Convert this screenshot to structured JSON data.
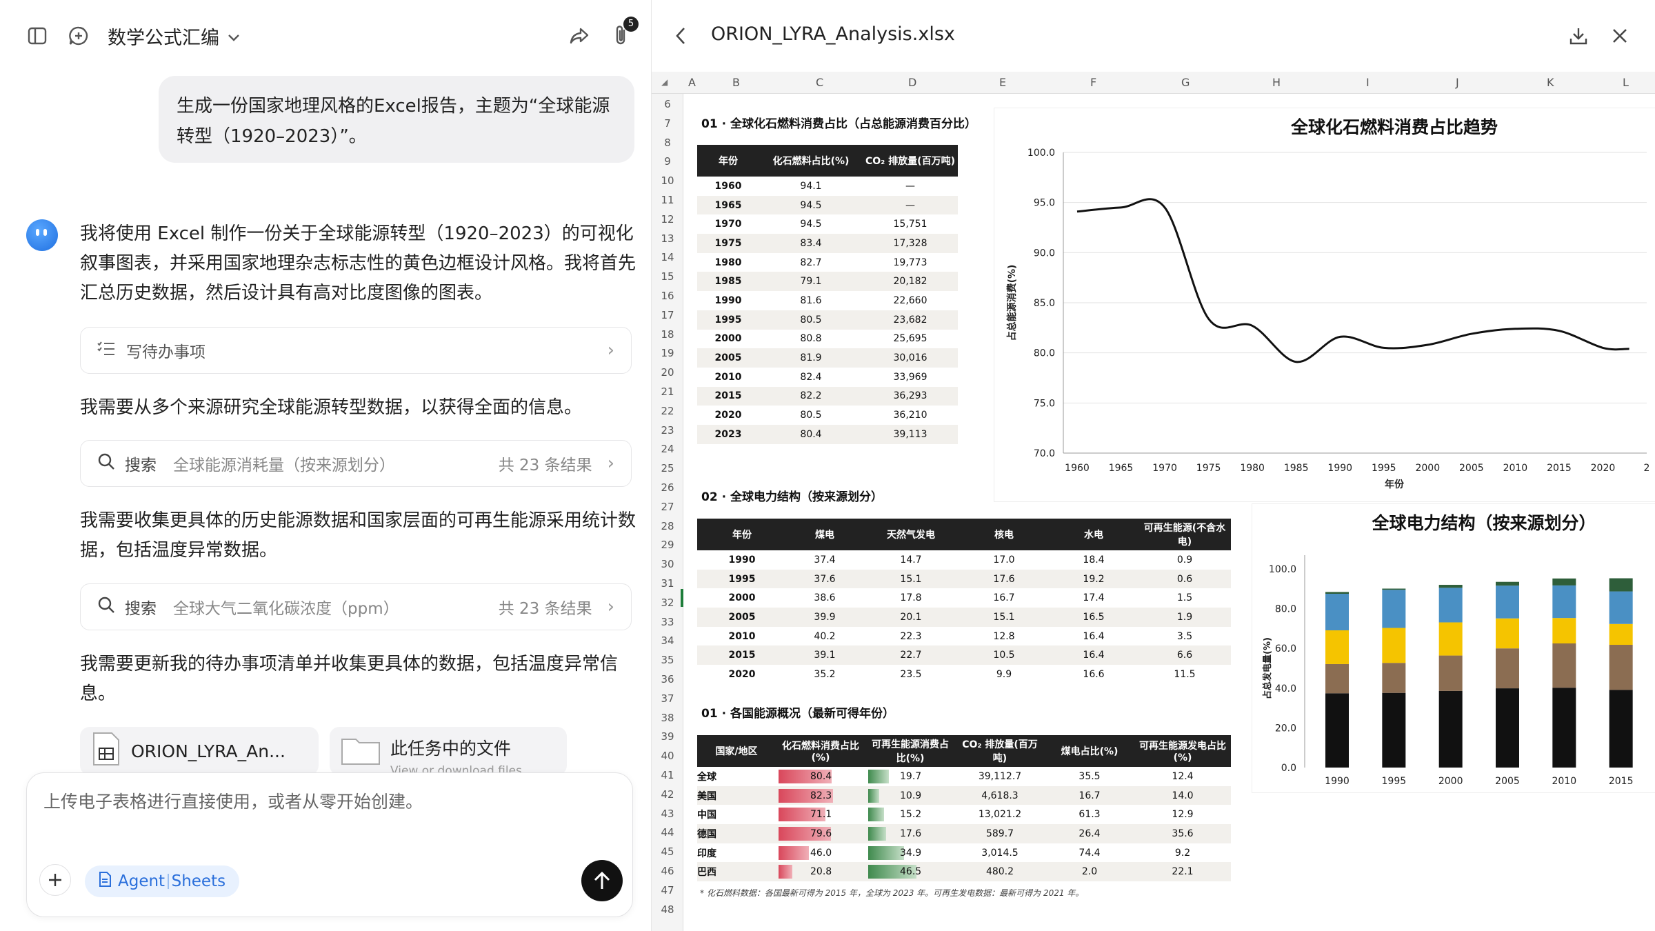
{
  "left": {
    "chat_title": "数学公式汇编",
    "attach_badge": "5",
    "user_message": "生成一份国家地理风格的Excel报告，主题为“全球能源转型（1920–2023）”。",
    "ai_intro": "我将使用 Excel 制作一份关于全球能源转型（1920–2023）的可视化叙事图表，并采用国家地理杂志标志性的黄色边框设计风格。我将首先汇总历史数据，然后设计具有高对比度图像的图表。",
    "todo_label": "写待办事项",
    "para2": "我需要从多个来源研究全球能源转型数据，以获得全面的信息。",
    "search1": {
      "label": "搜索",
      "query": "全球能源消耗量（按来源划分）",
      "count": "共 23 条结果"
    },
    "para3": "我需要收集更具体的历史能源数据和国家层面的可再生能源采用统计数据，包括温度异常数据。",
    "search2": {
      "label": "搜索",
      "query": "全球大气二氧化碳浓度（ppm）",
      "count": "共 23 条结果"
    },
    "para4": "我需要更新我的待办事项清单并收集更具体的数据，包括温度异常信息。",
    "file1": "ORION_LYRA_An...",
    "file2": "此任务中的文件",
    "file2_sub": "View or download files",
    "input_placeholder": "上传电子表格进行直接使用，或者从零开始创建。",
    "agent_label": "Agent",
    "sheets_label": "Sheets"
  },
  "right": {
    "file_title": "ORION_LYRA_Analysis.xlsx",
    "col_headers": [
      "A",
      "B",
      "C",
      "D",
      "E",
      "F",
      "G",
      "H",
      "I",
      "J",
      "K",
      "L"
    ],
    "row_numbers": [
      "6",
      "7",
      "8",
      "9",
      "10",
      "11",
      "12",
      "13",
      "14",
      "15",
      "16",
      "17",
      "18",
      "19",
      "20",
      "21",
      "22",
      "23",
      "24",
      "25",
      "26",
      "27",
      "28",
      "29",
      "30",
      "31",
      "32",
      "33",
      "34",
      "35",
      "36",
      "37",
      "38",
      "39",
      "40",
      "41",
      "42",
      "43",
      "44",
      "45",
      "46",
      "47",
      "48"
    ],
    "sec1": {
      "title": "01 · 全球化石燃料消费占比（占总能源消费百分比）",
      "headers": [
        "年份",
        "化石燃料占比(%)",
        "CO₂ 排放量(百万吨)"
      ],
      "rows": [
        [
          "1960",
          "94.1",
          "—"
        ],
        [
          "1965",
          "94.5",
          "—"
        ],
        [
          "1970",
          "94.5",
          "15,751"
        ],
        [
          "1975",
          "83.4",
          "17,328"
        ],
        [
          "1980",
          "82.7",
          "19,773"
        ],
        [
          "1985",
          "79.1",
          "20,182"
        ],
        [
          "1990",
          "81.6",
          "22,660"
        ],
        [
          "1995",
          "80.5",
          "23,682"
        ],
        [
          "2000",
          "80.8",
          "25,695"
        ],
        [
          "2005",
          "81.9",
          "30,016"
        ],
        [
          "2010",
          "82.4",
          "33,969"
        ],
        [
          "2015",
          "82.2",
          "36,293"
        ],
        [
          "2020",
          "80.5",
          "36,210"
        ],
        [
          "2023",
          "80.4",
          "39,113"
        ]
      ]
    },
    "sec2": {
      "title": "02 · 全球电力结构（按来源划分）",
      "headers": [
        "年份",
        "煤电",
        "天然气发电",
        "核电",
        "水电",
        "可再生能源(不含水电)"
      ],
      "rows": [
        [
          "1990",
          "37.4",
          "14.7",
          "17.0",
          "18.4",
          "0.9"
        ],
        [
          "1995",
          "37.6",
          "15.1",
          "17.6",
          "19.2",
          "0.6"
        ],
        [
          "2000",
          "38.6",
          "17.8",
          "16.7",
          "17.4",
          "1.5"
        ],
        [
          "2005",
          "39.9",
          "20.1",
          "15.1",
          "16.5",
          "1.9"
        ],
        [
          "2010",
          "40.2",
          "22.3",
          "12.8",
          "16.4",
          "3.5"
        ],
        [
          "2015",
          "39.1",
          "22.7",
          "10.5",
          "16.4",
          "6.6"
        ],
        [
          "2020",
          "35.2",
          "23.5",
          "9.9",
          "16.6",
          "11.5"
        ]
      ]
    },
    "sec3": {
      "title": "01 · 各国能源概况（最新可得年份）",
      "headers": [
        "国家/地区",
        "化石燃料消费占比(%)",
        "可再生能源消费占比(%)",
        "CO₂ 排放量(百万吨)",
        "煤电占比(%)",
        "可再生能源发电占比(%)"
      ],
      "rows": [
        [
          "全球",
          "80.4",
          "19.7",
          "39,112.7",
          "35.5",
          "12.4"
        ],
        [
          "美国",
          "82.3",
          "10.9",
          "4,618.3",
          "16.7",
          "14.0"
        ],
        [
          "中国",
          "71.1",
          "15.2",
          "13,021.2",
          "61.3",
          "12.9"
        ],
        [
          "德国",
          "79.6",
          "17.6",
          "589.7",
          "26.4",
          "35.6"
        ],
        [
          "印度",
          "46.0",
          "34.9",
          "3,014.5",
          "74.4",
          "9.2"
        ],
        [
          "巴西",
          "20.8",
          "46.5",
          "480.2",
          "2.0",
          "22.1"
        ]
      ],
      "fossil_bar_values": [
        80.4,
        82.3,
        71.1,
        79.6,
        46.0,
        20.8
      ],
      "renew_bar_values": [
        19.7,
        10.9,
        15.2,
        17.6,
        34.9,
        46.5
      ]
    },
    "footnote": "* 化石燃料数据：各国最新可得为 2015 年，全球为 2023 年。可再生发电数据：最新可得为 2021 年。"
  },
  "chart_data": [
    {
      "type": "line",
      "title": "全球化石燃料消费占比趋势",
      "xlabel": "年份",
      "ylabel": "占总能源消费(%)",
      "ylim": [
        70,
        100
      ],
      "yticks": [
        "100.0",
        "95.0",
        "90.0",
        "85.0",
        "80.0",
        "75.0",
        "70.0"
      ],
      "xticks": [
        "1960",
        "1965",
        "1970",
        "1975",
        "1980",
        "1985",
        "1990",
        "1995",
        "2000",
        "2005",
        "2010",
        "2015",
        "2020",
        "2"
      ],
      "x": [
        1960,
        1965,
        1970,
        1975,
        1980,
        1985,
        1990,
        1995,
        2000,
        2005,
        2010,
        2015,
        2020,
        2023
      ],
      "y": [
        94.1,
        94.5,
        94.5,
        83.4,
        82.7,
        79.1,
        81.6,
        80.5,
        80.8,
        81.9,
        82.4,
        82.2,
        80.5,
        80.4
      ]
    },
    {
      "type": "bar",
      "stacked": true,
      "title": "全球电力结构（按来源划分）",
      "ylabel": "占总发电量(%)",
      "ylim": [
        0,
        100
      ],
      "yticks": [
        "100.0",
        "80.0",
        "60.0",
        "40.0",
        "20.0",
        "0.0"
      ],
      "categories": [
        "1990",
        "1995",
        "2000",
        "2005",
        "2010",
        "2015"
      ],
      "colors": [
        "#111111",
        "#8b6d52",
        "#f5c400",
        "#4a90c4",
        "#2e5e3a"
      ],
      "series": [
        {
          "values": [
            37.4,
            37.6,
            38.6,
            39.9,
            40.2,
            39.1
          ]
        },
        {
          "values": [
            14.7,
            15.1,
            17.8,
            20.1,
            22.3,
            22.7
          ]
        },
        {
          "values": [
            17.0,
            17.6,
            16.7,
            15.1,
            12.8,
            10.5
          ]
        },
        {
          "values": [
            18.4,
            19.2,
            17.4,
            16.5,
            16.4,
            16.4
          ]
        },
        {
          "values": [
            0.9,
            0.6,
            1.5,
            1.9,
            3.5,
            6.6
          ]
        }
      ]
    }
  ]
}
